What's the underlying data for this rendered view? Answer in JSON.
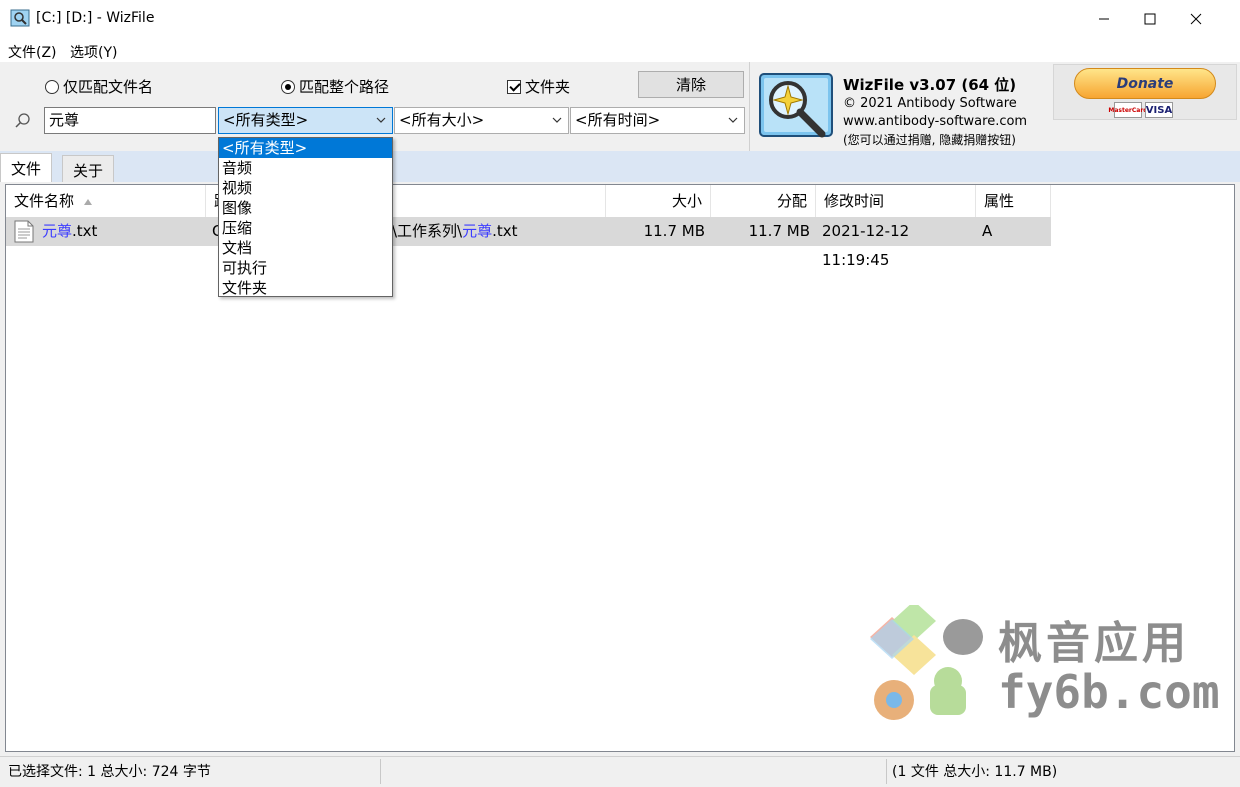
{
  "window": {
    "title": "[C:] [D:]  - WizFile"
  },
  "menu": {
    "file": "文件(Z)",
    "options": "选项(Y)"
  },
  "search": {
    "radio_filename": "仅匹配文件名",
    "radio_fullpath": "匹配整个路径",
    "fullpath_selected": true,
    "checkbox_folder": "文件夹",
    "folder_checked": true,
    "clear_button": "清除",
    "query": "元尊",
    "type_filter": "<所有类型>",
    "size_filter": "<所有大小>",
    "time_filter": "<所有时间>"
  },
  "about": {
    "app_name": "WizFile v3.07 (64 位)",
    "copyright": "© 2021 Antibody Software",
    "url": "www.antibody-software.com",
    "note": "(您可以通过捐赠, 隐藏捐赠按钮)",
    "donate_label": "Donate",
    "card_mastercard": "MasterCard",
    "card_visa": "VISA"
  },
  "tabs": [
    {
      "label": "文件",
      "active": true
    },
    {
      "label": "关于",
      "active": false
    }
  ],
  "table": {
    "columns": {
      "name": "文件名称",
      "path": "路",
      "size": "大小",
      "alloc": "分配",
      "modified": "修改时间",
      "attr": "属性"
    },
    "rows": [
      {
        "name_hl": "元尊",
        "name_rest": ".txt",
        "path_start": "C",
        "path_mid": "\\工作系列\\",
        "path_hl": "元尊",
        "path_end": ".txt",
        "size": "11.7 MB",
        "alloc": "11.7 MB",
        "modified": "2021-12-12 11:19:45",
        "attr": "A"
      }
    ]
  },
  "dropdown": {
    "items": [
      "<所有类型>",
      "音频",
      "视频",
      "图像",
      "压缩",
      "文档",
      "可执行",
      "文件夹"
    ],
    "selected_index": 0
  },
  "watermark": {
    "title": "枫音应用",
    "domain": "fy6b.com"
  },
  "status": {
    "selected": "已选择文件: 1  总大小: 724 字节",
    "total": "(1 文件  总大小: 11.7 MB)"
  },
  "colors": {
    "accent": "#0078d7",
    "highlight_text": "#3c3cff",
    "selected_row": "#d9d9d9",
    "tab_strip": "#dbe6f4"
  }
}
